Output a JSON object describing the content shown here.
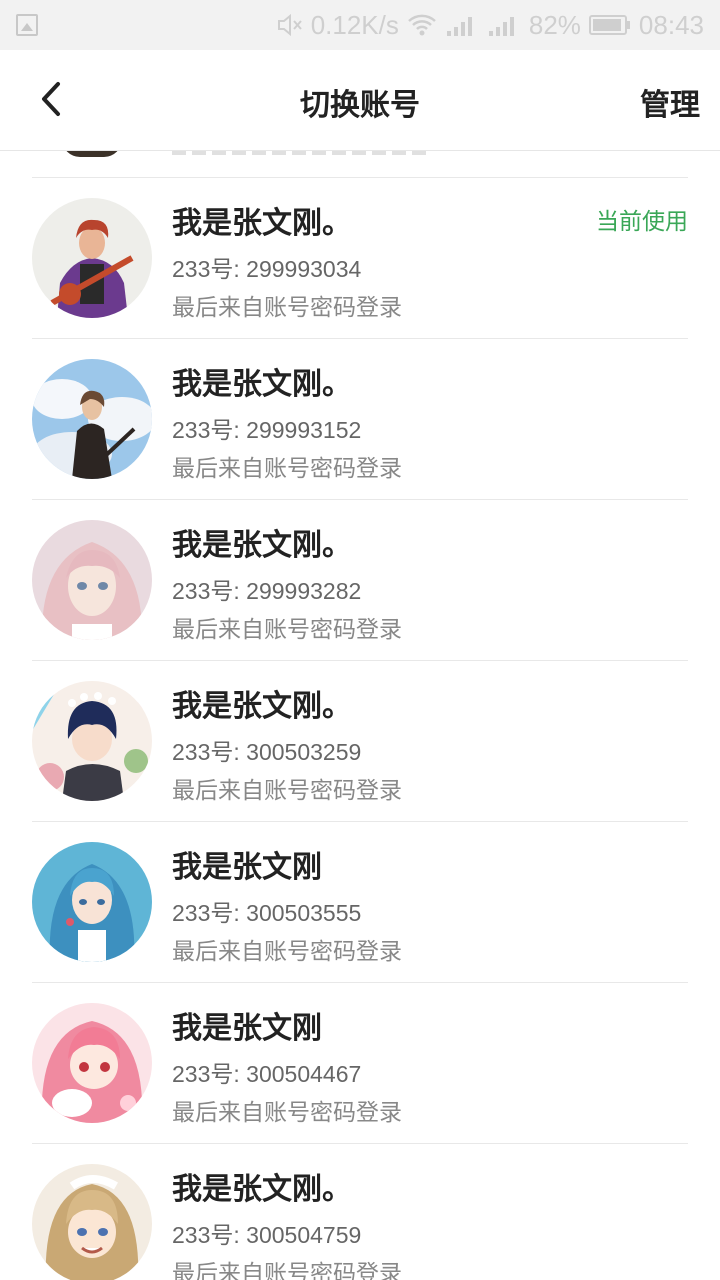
{
  "status_bar": {
    "net_speed": "0.12K/s",
    "battery": "82%",
    "time": "08:43",
    "icons": [
      "image-icon",
      "mute-icon",
      "wifi-icon",
      "signal-icon",
      "signal-icon-2",
      "battery-icon"
    ]
  },
  "header": {
    "title": "切换账号",
    "manage_label": "管理",
    "back_icon": "back-chevron-icon"
  },
  "accounts": [
    {
      "name": "我是张文刚。",
      "uid": "233号: 299993034",
      "source": "最后来自账号密码登录",
      "current_label": "当前使用"
    },
    {
      "name": "我是张文刚。",
      "uid": "233号: 299993152",
      "source": "最后来自账号密码登录"
    },
    {
      "name": "我是张文刚。",
      "uid": "233号: 299993282",
      "source": "最后来自账号密码登录"
    },
    {
      "name": "我是张文刚。",
      "uid": "233号: 300503259",
      "source": "最后来自账号密码登录"
    },
    {
      "name": "我是张文刚",
      "uid": "233号: 300503555",
      "source": "最后来自账号密码登录"
    },
    {
      "name": "我是张文刚",
      "uid": "233号: 300504467",
      "source": "最后来自账号密码登录"
    },
    {
      "name": "我是张文刚。",
      "uid": "233号: 300504759",
      "source": "最后来自账号密码登录"
    }
  ],
  "colors": {
    "accent_green": "#3aa757",
    "status_bar_bg": "#f2f2f2"
  }
}
